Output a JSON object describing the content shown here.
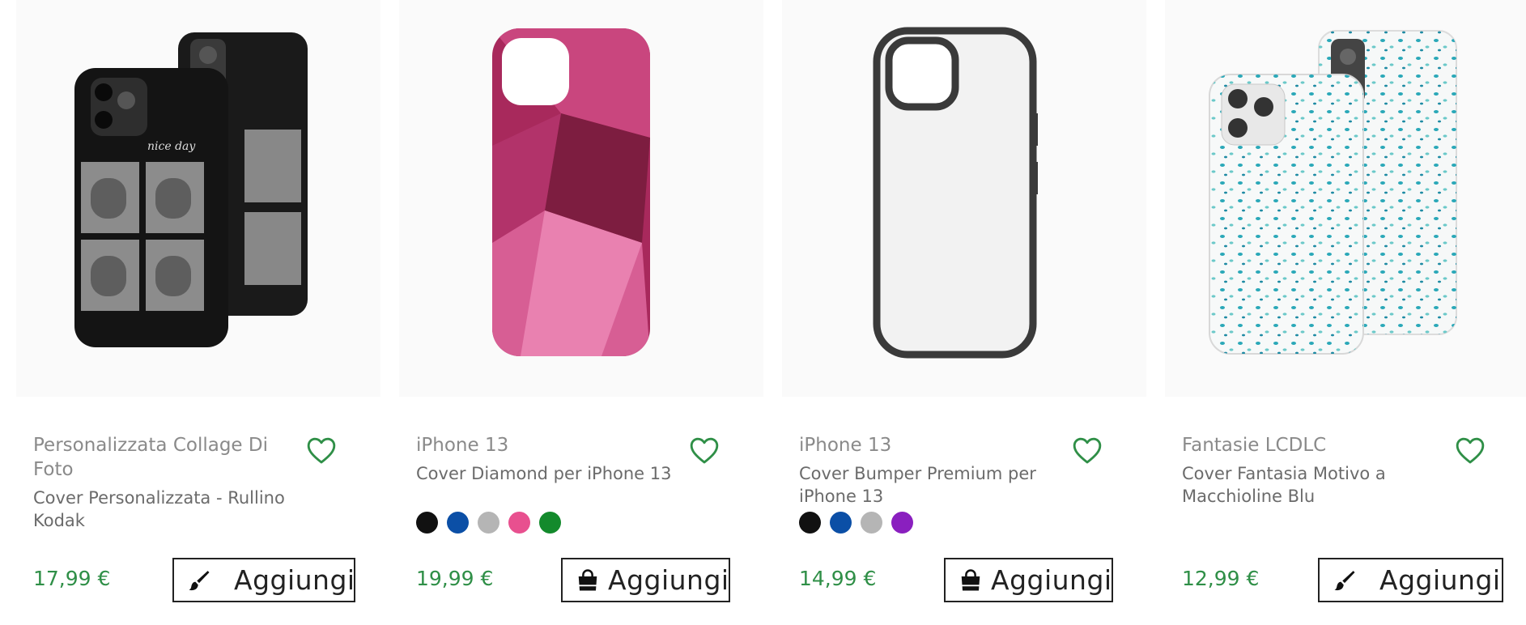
{
  "products": [
    {
      "brand": "Personalizzata Collage Di Foto",
      "title": "Cover Personalizzata - Rullino Kodak",
      "price": "17,99 €",
      "button_label": "Aggiungi",
      "button_icon": "brush-icon",
      "image_text": "nice day",
      "colors": []
    },
    {
      "brand": "iPhone 13",
      "title": "Cover Diamond per iPhone 13",
      "price": "19,99 €",
      "button_label": "Aggiungi",
      "button_icon": "shopping-bag-icon",
      "colors": [
        "#111111",
        "#0b4fa6",
        "#b5b5b5",
        "#e8508f",
        "#138a2c"
      ]
    },
    {
      "brand": "iPhone 13",
      "title": "Cover Bumper Premium per iPhone 13",
      "price": "14,99 €",
      "button_label": "Aggiungi",
      "button_icon": "shopping-bag-icon",
      "colors": [
        "#111111",
        "#0b4fa6",
        "#b5b5b5",
        "#8a1fbf"
      ]
    },
    {
      "brand": "Fantasie LCDLC",
      "title": "Cover Fantasia Motivo a Macchioline Blu",
      "price": "12,99 €",
      "button_label": "Aggiungi",
      "button_icon": "brush-icon",
      "colors": []
    }
  ],
  "theme": {
    "price_color": "#2f8f47",
    "heart_color": "#2f8f47"
  }
}
